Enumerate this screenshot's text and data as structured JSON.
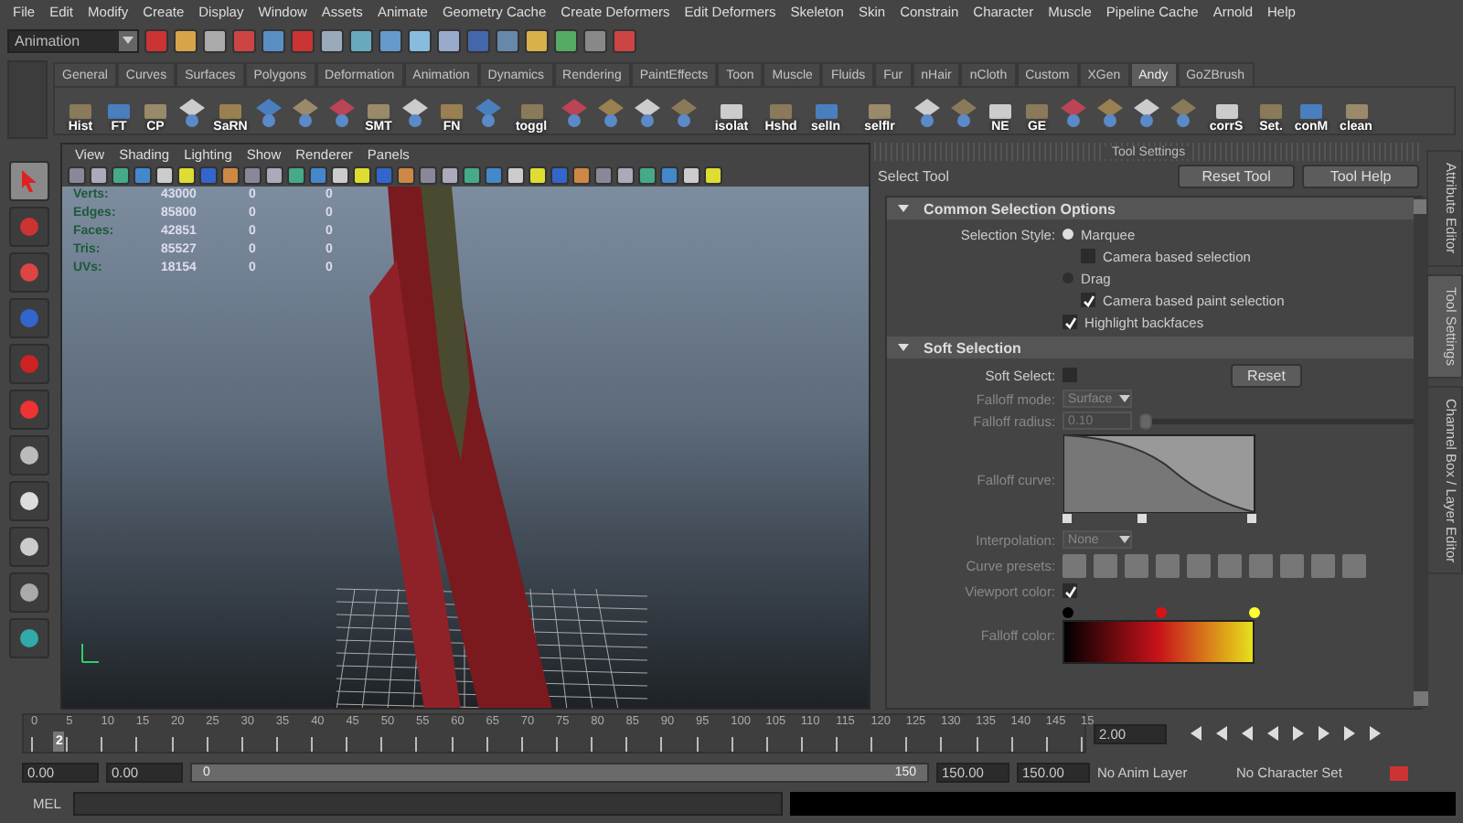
{
  "menu_bar": [
    "File",
    "Edit",
    "Modify",
    "Create",
    "Display",
    "Window",
    "Assets",
    "Animate",
    "Geometry Cache",
    "Create Deformers",
    "Edit Deformers",
    "Skeleton",
    "Skin",
    "Constrain",
    "Character",
    "Muscle",
    "Pipeline Cache",
    "Arnold",
    "Help"
  ],
  "status_line": {
    "mode": "Animation"
  },
  "shelf": {
    "tabs": [
      {
        "label": "General",
        "selected": false
      },
      {
        "label": "Curves",
        "selected": false
      },
      {
        "label": "Surfaces",
        "selected": false
      },
      {
        "label": "Polygons",
        "selected": false
      },
      {
        "label": "Deformation",
        "selected": false
      },
      {
        "label": "Animation",
        "selected": false
      },
      {
        "label": "Dynamics",
        "selected": false
      },
      {
        "label": "Rendering",
        "selected": false
      },
      {
        "label": "PaintEffects",
        "selected": false
      },
      {
        "label": "Toon",
        "selected": false
      },
      {
        "label": "Muscle",
        "selected": false
      },
      {
        "label": "Fluids",
        "selected": false
      },
      {
        "label": "Fur",
        "selected": false
      },
      {
        "label": "nHair",
        "selected": false
      },
      {
        "label": "nCloth",
        "selected": false
      },
      {
        "label": "Custom",
        "selected": false
      },
      {
        "label": "XGen",
        "selected": false
      },
      {
        "label": "Andy",
        "selected": true
      },
      {
        "label": "GoZBrush",
        "selected": false
      }
    ],
    "items": [
      {
        "kind": "tool",
        "label": "Hist"
      },
      {
        "kind": "tool",
        "label": "FT"
      },
      {
        "kind": "tool",
        "label": "CP"
      },
      {
        "kind": "icon"
      },
      {
        "kind": "tool",
        "label": "SaRN"
      },
      {
        "kind": "icon"
      },
      {
        "kind": "icon"
      },
      {
        "kind": "icon"
      },
      {
        "kind": "tool",
        "label": "SMT"
      },
      {
        "kind": "icon"
      },
      {
        "kind": "tool",
        "label": "FN"
      },
      {
        "kind": "icon"
      },
      {
        "kind": "tool",
        "label": "toggl"
      },
      {
        "kind": "icon"
      },
      {
        "kind": "icon"
      },
      {
        "kind": "icon"
      },
      {
        "kind": "icon"
      },
      {
        "kind": "tool",
        "label": "isolat"
      },
      {
        "kind": "tool",
        "label": "Hshd"
      },
      {
        "kind": "tool",
        "label": "selIn"
      },
      {
        "kind": "tool",
        "label": "selfIr"
      },
      {
        "kind": "icon"
      },
      {
        "kind": "icon"
      },
      {
        "kind": "tool",
        "label": "NE"
      },
      {
        "kind": "tool",
        "label": "GE"
      },
      {
        "kind": "icon"
      },
      {
        "kind": "icon"
      },
      {
        "kind": "icon"
      },
      {
        "kind": "icon"
      },
      {
        "kind": "tool",
        "label": "corrS"
      },
      {
        "kind": "tool",
        "label": "Set."
      },
      {
        "kind": "tool",
        "label": "conM"
      },
      {
        "kind": "tool",
        "label": "clean"
      }
    ]
  },
  "toolbox": [
    {
      "selected": true
    },
    {
      "selected": false
    },
    {
      "selected": false
    },
    {
      "selected": false
    },
    {
      "selected": false
    },
    {
      "selected": false
    },
    {
      "selected": false
    },
    {
      "selected": false
    },
    {
      "selected": false
    },
    {
      "selected": false
    },
    {
      "selected": false
    }
  ],
  "viewport": {
    "menu": [
      "View",
      "Shading",
      "Lighting",
      "Show",
      "Renderer",
      "Panels"
    ],
    "stats": [
      {
        "label": "Verts:",
        "values": [
          "43000",
          "0",
          "0"
        ]
      },
      {
        "label": "Edges:",
        "values": [
          "85800",
          "0",
          "0"
        ]
      },
      {
        "label": "Faces:",
        "values": [
          "42851",
          "0",
          "0"
        ]
      },
      {
        "label": "Tris:",
        "values": [
          "85527",
          "0",
          "0"
        ]
      },
      {
        "label": "UVs:",
        "values": [
          "18154",
          "0",
          "0"
        ]
      }
    ]
  },
  "tool_settings": {
    "title": "Tool Settings",
    "tool_name": "Select Tool",
    "buttons": [
      "Reset Tool",
      "Tool Help"
    ],
    "common": {
      "title": "Common Selection Options",
      "expanded": true,
      "style_label": "Selection Style:",
      "marquee": {
        "label": "Marquee",
        "selected": true
      },
      "camera_based_selection": {
        "label": "Camera based selection",
        "checked": false
      },
      "drag": {
        "label": "Drag",
        "selected": false
      },
      "camera_based_paint": {
        "label": "Camera based paint selection",
        "checked": true
      },
      "highlight_backfaces": {
        "label": "Highlight backfaces",
        "checked": true
      }
    },
    "soft": {
      "title": "Soft Selection",
      "expanded": true,
      "soft_select": {
        "label": "Soft Select:",
        "checked": false
      },
      "reset": "Reset",
      "falloff_mode": {
        "label": "Falloff mode:",
        "value": "Surface"
      },
      "falloff_radius": {
        "label": "Falloff radius:",
        "value": "0.10",
        "level": 0
      },
      "falloff_curve": "Falloff curve:",
      "interpolation": {
        "label": "Interpolation:",
        "value": "None"
      },
      "curve_presets": "Curve presets:",
      "viewport_color": {
        "label": "Viewport color:",
        "checked": true
      },
      "falloff_color": "Falloff color:"
    }
  },
  "side_tabs": [
    {
      "label": "Attribute Editor",
      "selected": false
    },
    {
      "label": "Tool Settings",
      "selected": true
    },
    {
      "label": "Channel Box / Layer Editor",
      "selected": false
    }
  ],
  "time_slider": {
    "ticks": [
      "0",
      "5",
      "10",
      "15",
      "20",
      "25",
      "30",
      "35",
      "40",
      "45",
      "50",
      "55",
      "60",
      "65",
      "70",
      "75",
      "80",
      "85",
      "90",
      "95",
      "100",
      "105",
      "110",
      "115",
      "120",
      "125",
      "130",
      "135",
      "140",
      "145",
      "15"
    ],
    "current": "2",
    "level": 0.013,
    "current_field": "2.00"
  },
  "range_slider": {
    "start": "0.00",
    "anim_start": "0.00",
    "range_start": "0",
    "range_end": "150",
    "level": 1,
    "anim_end": "150.00",
    "end": "150.00",
    "anim_layer": "No Anim Layer",
    "character_set": "No Character Set"
  },
  "command_line": {
    "label": "MEL"
  }
}
